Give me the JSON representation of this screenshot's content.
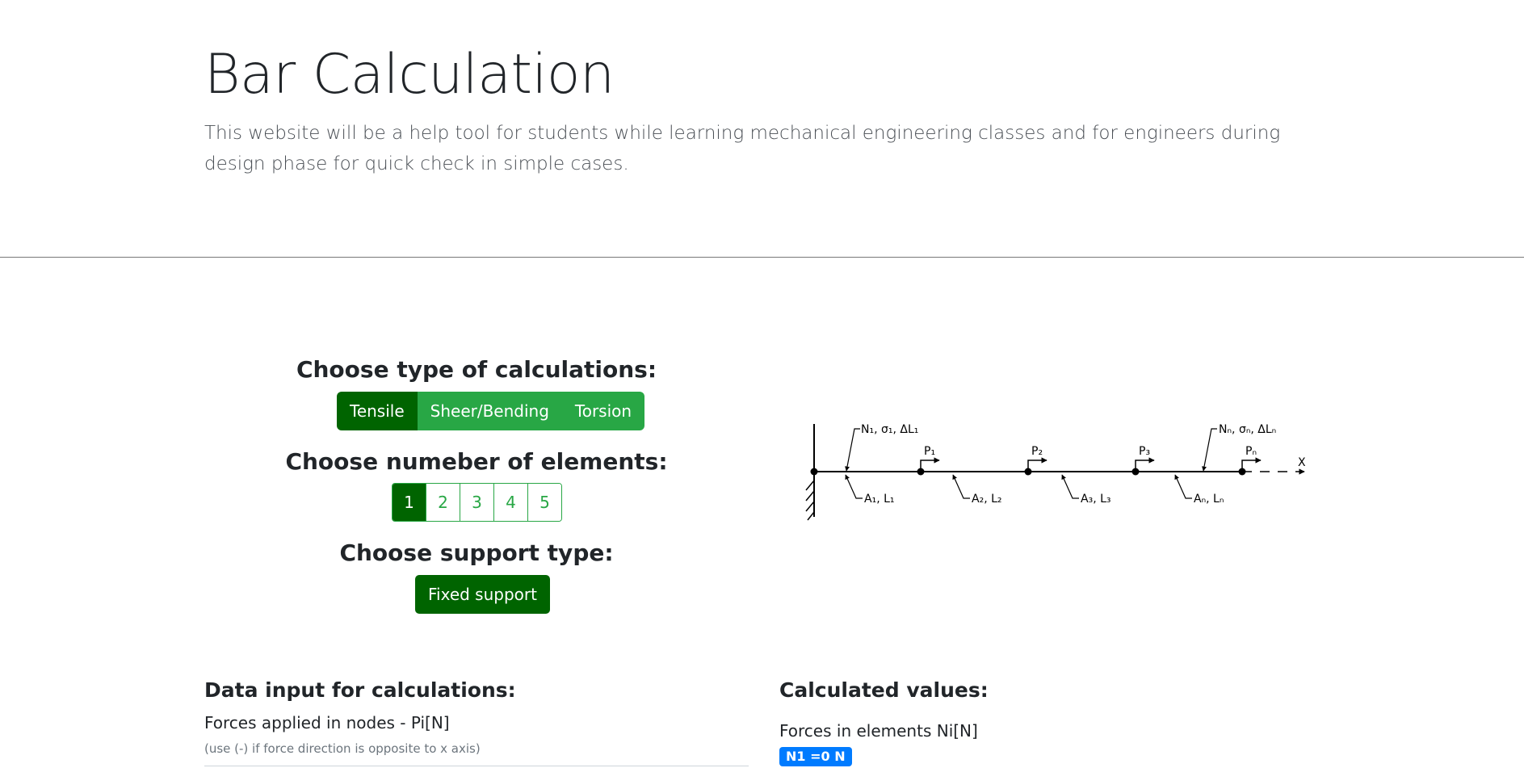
{
  "header": {
    "title": "Bar Calculation",
    "description": "This website will be a help tool for students while learning mechanical engineering classes and for engineers during design phase for quick check in simple cases."
  },
  "calc_type": {
    "heading": "Choose type of calculations:",
    "options": [
      "Tensile",
      "Sheer/Bending",
      "Torsion"
    ],
    "selected": "Tensile"
  },
  "elements": {
    "heading": "Choose numeber of elements:",
    "options": [
      "1",
      "2",
      "3",
      "4",
      "5"
    ],
    "selected": "1"
  },
  "support": {
    "heading": "Choose support type:",
    "button": "Fixed support"
  },
  "diagram": {
    "top_labels": [
      "N₁, σ₁, ΔL₁",
      "Nₙ, σₙ, ΔLₙ"
    ],
    "force_labels": [
      "P₁",
      "P₂",
      "P₃",
      "Pₙ"
    ],
    "bottom_labels": [
      "A₁, L₁",
      "A₂, L₂",
      "A₃, L₃",
      "Aₙ, Lₙ"
    ],
    "axis_label": "X"
  },
  "data_input": {
    "heading": "Data input for calculations:",
    "forces_label": "Forces applied in nodes - Pi[N]",
    "forces_hint": "(use (-) if force direction is opposite to x axis)"
  },
  "results": {
    "heading": "Calculated values:",
    "forces_label": "Forces in elements Ni[N]",
    "badge": "N1 =0 N"
  },
  "colors": {
    "primary_green": "#28a745",
    "active_green": "#006400",
    "badge_blue": "#007bff"
  }
}
